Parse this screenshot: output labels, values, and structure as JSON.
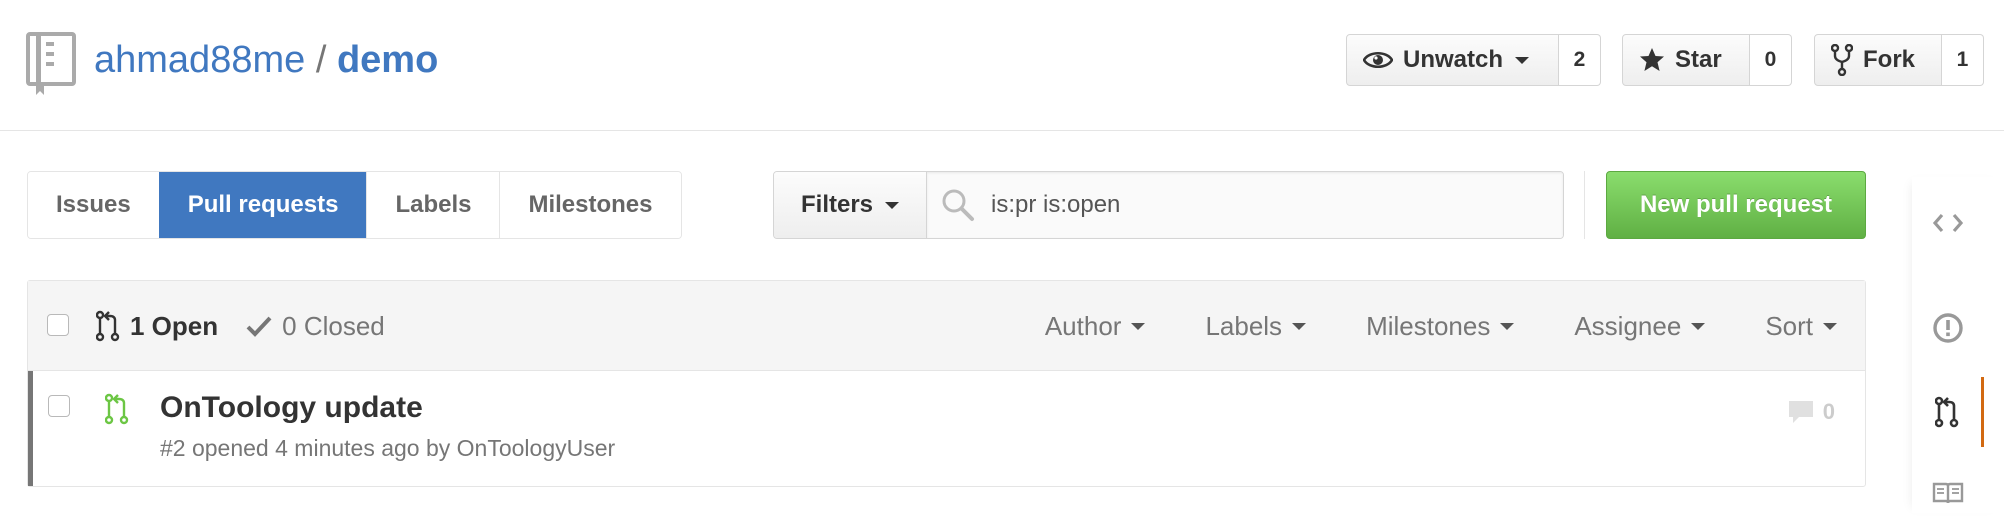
{
  "repo": {
    "owner": "ahmad88me",
    "separator": "/",
    "name": "demo",
    "icon": "repo-icon"
  },
  "actions": {
    "watch": {
      "label": "Unwatch",
      "count": "2",
      "icon": "eye-icon"
    },
    "star": {
      "label": "Star",
      "count": "0",
      "icon": "star-icon"
    },
    "fork": {
      "label": "Fork",
      "count": "1",
      "icon": "fork-icon"
    }
  },
  "subnav": {
    "tabs": [
      {
        "label": "Issues",
        "selected": false
      },
      {
        "label": "Pull requests",
        "selected": true
      },
      {
        "label": "Labels",
        "selected": false
      },
      {
        "label": "Milestones",
        "selected": false
      }
    ]
  },
  "filters": {
    "button_label": "Filters",
    "search_value": "is:pr is:open",
    "search_icon": "search-icon"
  },
  "new_pr_label": "New pull request",
  "table": {
    "open_label": "1 Open",
    "closed_label": "0 Closed",
    "filters": [
      "Author",
      "Labels",
      "Milestones",
      "Assignee",
      "Sort"
    ],
    "rows": [
      {
        "title": "OnToology update",
        "meta": "#2 opened 4 minutes ago by OnToologyUser",
        "comments": "0"
      }
    ]
  },
  "colors": {
    "link": "#4078c0",
    "selected_tab": "#4078c0",
    "new_pr_green": "#60b044",
    "open_pr_icon": "#6cc644",
    "sidenav_accent": "#d26911"
  },
  "sidenav": {
    "items": [
      {
        "icon": "code-icon",
        "selected": false
      },
      {
        "icon": "issue-icon",
        "selected": false
      },
      {
        "icon": "pull-request-icon",
        "selected": true
      },
      {
        "icon": "wiki-book-icon",
        "selected": false
      }
    ]
  }
}
